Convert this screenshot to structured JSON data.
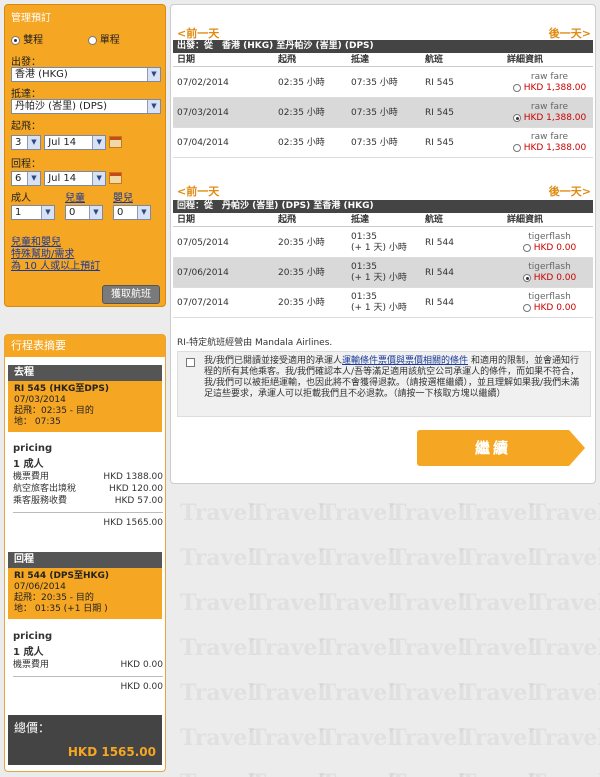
{
  "booking": {
    "title": "管理預訂",
    "roundtrip": "雙程",
    "oneway": "單程",
    "from_label": "出發：",
    "from_value": "香港 (HKG)",
    "to_label": "抵達：",
    "to_value": "丹帕沙 (峇里) (DPS)",
    "depart_label": "起飛：",
    "depart_day": "3",
    "depart_month": "Jul 14",
    "return_label": "回程：",
    "return_day": "6",
    "return_month": "Jul 14",
    "adult_label": "成人",
    "child_label": "兒童",
    "infant_label": "嬰兒",
    "adult_value": "1",
    "child_value": "0",
    "infant_value": "0",
    "link1": "兒童和嬰兒",
    "link2": "特殊幫助/需求",
    "link3": "為 10 人或以上預訂",
    "search": "獲取航班"
  },
  "itinerary": {
    "title": "行程表摘要",
    "out": {
      "header": "去程",
      "flight": "RI 545 (HKG至DPS)",
      "date": "07/03/2014",
      "dep": "起飛：02:35 - 目的",
      "arr": "地： 07:35"
    },
    "out_pricing": {
      "label": "pricing",
      "pax": "1 成人",
      "l1": "機票費用",
      "v1": "HKD 1388.00",
      "l2": "航空旅客出境稅",
      "v2": "HKD 120.00",
      "l3": "乘客服務收費",
      "v3": "HKD 57.00",
      "subtotal": "HKD 1565.00"
    },
    "ret": {
      "header": "回程",
      "flight": "RI 544 (DPS至HKG)",
      "date": "07/06/2014",
      "dep": "起飛：20:35 - 目的",
      "arr": "地： 01:35 (+1 日期 )"
    },
    "ret_pricing": {
      "label": "pricing",
      "pax": "1 成人",
      "l1": "機票費用",
      "v1": "HKD 0.00",
      "subtotal": "HKD 0.00"
    },
    "total_label": "總價：",
    "total_value": "HKD  1565.00"
  },
  "outbound": {
    "prev": "<前一天",
    "next": "後一天>",
    "bar": "出發：從　香港 (HKG) 至丹帕沙 (峇里) (DPS)",
    "cols": [
      "日期",
      "起飛",
      "抵達",
      "航班",
      "詳細資訊"
    ],
    "rows": [
      {
        "date": "07/02/2014",
        "dep": "02:35 小時",
        "arr": "07:35 小時",
        "flight": "RI 545",
        "fare": "raw fare",
        "price": "HKD 1,388.00",
        "selected": false
      },
      {
        "date": "07/03/2014",
        "dep": "02:35 小時",
        "arr": "07:35 小時",
        "flight": "RI 545",
        "fare": "raw fare",
        "price": "HKD 1,388.00",
        "selected": true
      },
      {
        "date": "07/04/2014",
        "dep": "02:35 小時",
        "arr": "07:35 小時",
        "flight": "RI 545",
        "fare": "raw fare",
        "price": "HKD 1,388.00",
        "selected": false
      }
    ]
  },
  "inbound": {
    "prev": "<前一天",
    "next": "後一天>",
    "bar": "回程：從　丹帕沙 (峇里) (DPS) 至香港 (HKG)",
    "cols": [
      "日期",
      "起飛",
      "抵達",
      "航班",
      "詳細資訊"
    ],
    "rows": [
      {
        "date": "07/05/2014",
        "dep": "20:35 小時",
        "arr1": "01:35",
        "arr2": "(+ 1 天) 小時",
        "flight": "RI 544",
        "fare": "tigerflash",
        "price": "HKD 0.00",
        "selected": false
      },
      {
        "date": "07/06/2014",
        "dep": "20:35 小時",
        "arr1": "01:35",
        "arr2": "(+ 1 天) 小時",
        "flight": "RI 544",
        "fare": "tigerflash",
        "price": "HKD 0.00",
        "selected": true
      },
      {
        "date": "07/07/2014",
        "dep": "20:35 小時",
        "arr1": "01:35",
        "arr2": "(+ 1 天) 小時",
        "flight": "RI 544",
        "fare": "tigerflash",
        "price": "HKD 0.00",
        "selected": false
      }
    ]
  },
  "note": "RI-特定航班經營由 Mandala Airlines.",
  "terms": {
    "t1": "我/我們已閱讀並接受適用的承運人",
    "link": "運輸條件票價與票價相關的條件",
    "t2": "和適用的限制，並會通知行程的所有其他乘客。我/我們確認本人/吾等滿足適用該航空公司承運人的條件，而如果不符合，我/我們可以被拒絕運輸，也因此將不會獲得退款。（請按選框繼續），並且理解如果我/我們未滿足這些要求，承運人可以拒載我們且不必退款。（請按一下核取方塊以繼續）"
  },
  "continue": "繼續",
  "watermark": "Travel"
}
